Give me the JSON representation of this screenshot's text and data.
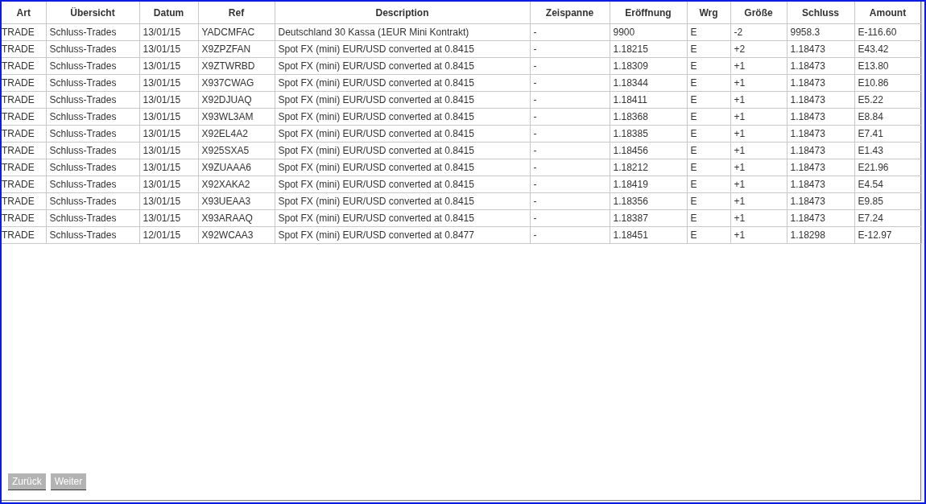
{
  "table": {
    "columns": [
      "Art",
      "Übersicht",
      "Datum",
      "Ref",
      "Description",
      "Zeispanne",
      "Eröffnung",
      "Wrg",
      "Größe",
      "Schluss",
      "Amount"
    ],
    "rows": [
      [
        "TRADE",
        "Schluss-Trades",
        "13/01/15",
        "YADCMFAC",
        "Deutschland 30 Kassa (1EUR Mini Kontrakt)",
        "-",
        "9900",
        "E",
        "-2",
        "9958.3",
        "E-116.60"
      ],
      [
        "TRADE",
        "Schluss-Trades",
        "13/01/15",
        "X9ZPZFAN",
        "Spot FX (mini) EUR/USD converted at 0.8415",
        "-",
        "1.18215",
        "E",
        "+2",
        "1.18473",
        "E43.42"
      ],
      [
        "TRADE",
        "Schluss-Trades",
        "13/01/15",
        "X9ZTWRBD",
        "Spot FX (mini) EUR/USD converted at 0.8415",
        "-",
        "1.18309",
        "E",
        "+1",
        "1.18473",
        "E13.80"
      ],
      [
        "TRADE",
        "Schluss-Trades",
        "13/01/15",
        "X937CWAG",
        "Spot FX (mini) EUR/USD converted at 0.8415",
        "-",
        "1.18344",
        "E",
        "+1",
        "1.18473",
        "E10.86"
      ],
      [
        "TRADE",
        "Schluss-Trades",
        "13/01/15",
        "X92DJUAQ",
        "Spot FX (mini) EUR/USD converted at 0.8415",
        "-",
        "1.18411",
        "E",
        "+1",
        "1.18473",
        "E5.22"
      ],
      [
        "TRADE",
        "Schluss-Trades",
        "13/01/15",
        "X93WL3AM",
        "Spot FX (mini) EUR/USD converted at 0.8415",
        "-",
        "1.18368",
        "E",
        "+1",
        "1.18473",
        "E8.84"
      ],
      [
        "TRADE",
        "Schluss-Trades",
        "13/01/15",
        "X92EL4A2",
        "Spot FX (mini) EUR/USD converted at 0.8415",
        "-",
        "1.18385",
        "E",
        "+1",
        "1.18473",
        "E7.41"
      ],
      [
        "TRADE",
        "Schluss-Trades",
        "13/01/15",
        "X925SXA5",
        "Spot FX (mini) EUR/USD converted at 0.8415",
        "-",
        "1.18456",
        "E",
        "+1",
        "1.18473",
        "E1.43"
      ],
      [
        "TRADE",
        "Schluss-Trades",
        "13/01/15",
        "X9ZUAAA6",
        "Spot FX (mini) EUR/USD converted at 0.8415",
        "-",
        "1.18212",
        "E",
        "+1",
        "1.18473",
        "E21.96"
      ],
      [
        "TRADE",
        "Schluss-Trades",
        "13/01/15",
        "X92XAKA2",
        "Spot FX (mini) EUR/USD converted at 0.8415",
        "-",
        "1.18419",
        "E",
        "+1",
        "1.18473",
        "E4.54"
      ],
      [
        "TRADE",
        "Schluss-Trades",
        "13/01/15",
        "X93UEAA3",
        "Spot FX (mini) EUR/USD converted at 0.8415",
        "-",
        "1.18356",
        "E",
        "+1",
        "1.18473",
        "E9.85"
      ],
      [
        "TRADE",
        "Schluss-Trades",
        "13/01/15",
        "X93ARAAQ",
        "Spot FX (mini) EUR/USD converted at 0.8415",
        "-",
        "1.18387",
        "E",
        "+1",
        "1.18473",
        "E7.24"
      ],
      [
        "TRADE",
        "Schluss-Trades",
        "12/01/15",
        "X92WCAA3",
        "Spot FX (mini) EUR/USD converted at 0.8477",
        "-",
        "1.18451",
        "E",
        "+1",
        "1.18298",
        "E-12.97"
      ]
    ]
  },
  "buttons": [
    "Zurück",
    "Weiter"
  ]
}
